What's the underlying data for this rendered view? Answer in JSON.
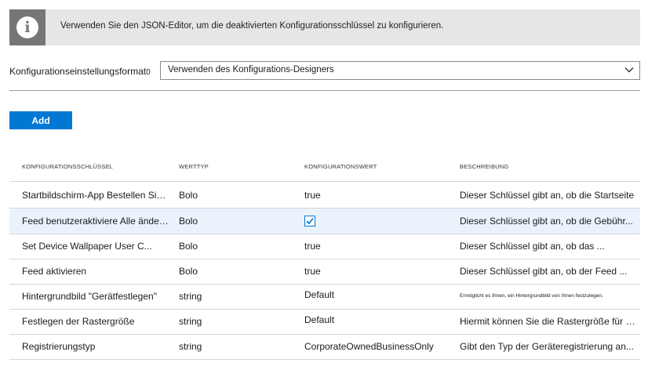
{
  "banner": {
    "text": "Verwenden Sie den JSON-Editor, um die deaktivierten Konfigurationsschlüssel zu konfigurieren.",
    "icon": "info-icon"
  },
  "format": {
    "label": "Konfigurationseinstellungsformat",
    "info_marker": "0",
    "selected": "Verwenden des Konfigurations-Designers"
  },
  "add_label": "Add",
  "table": {
    "headers": [
      "KONFIGURATIONSSCHLÜSSEL",
      "WERTTYP",
      "KONFIGURATIONSWERT",
      "BESCHREIBUNG"
    ],
    "rows": [
      {
        "key": "Startbildschirm-App Bestellen Sie uns...",
        "type": "Bolo",
        "value": "true",
        "desc": "Dieser Schlüssel gibt an, ob die Startseite"
      },
      {
        "key": "Feed benutzeraktiviere Alle ändern...",
        "type": "Bolo",
        "value": "checked",
        "desc": "Dieser Schlüssel gibt an, ob die Gebühr..."
      },
      {
        "key": "Set Device Wallpaper User C...",
        "type": "Bolo",
        "value": "true",
        "desc": "Dieser Schlüssel gibt an, ob das ..."
      },
      {
        "key": "Feed aktivieren",
        "type": "Bolo",
        "value": "true",
        "desc": "Dieser Schlüssel gibt an, ob der Feed ..."
      },
      {
        "key": "Hintergrundbild \"Gerätfestlegen\"",
        "type": "string",
        "value": "Default",
        "desc": "Ermöglicht es Ihnen, ein Hintergrundbild von Ihnen festzulegen."
      },
      {
        "key": "Festlegen der Rastergröße",
        "type": "string",
        "value": "Default",
        "desc": "Hiermit können Sie die Rastergröße für ein..."
      },
      {
        "key": "Registrierungstyp",
        "type": "string",
        "value": "CorporateOwnedBusinessOnly",
        "desc": "Gibt den Typ der Geräteregistrierung an..."
      }
    ]
  },
  "colors": {
    "accent": "#0078d4",
    "banner_bg": "#e6e6e6",
    "info_box": "#767676",
    "selected_row": "#eaf3fc"
  }
}
